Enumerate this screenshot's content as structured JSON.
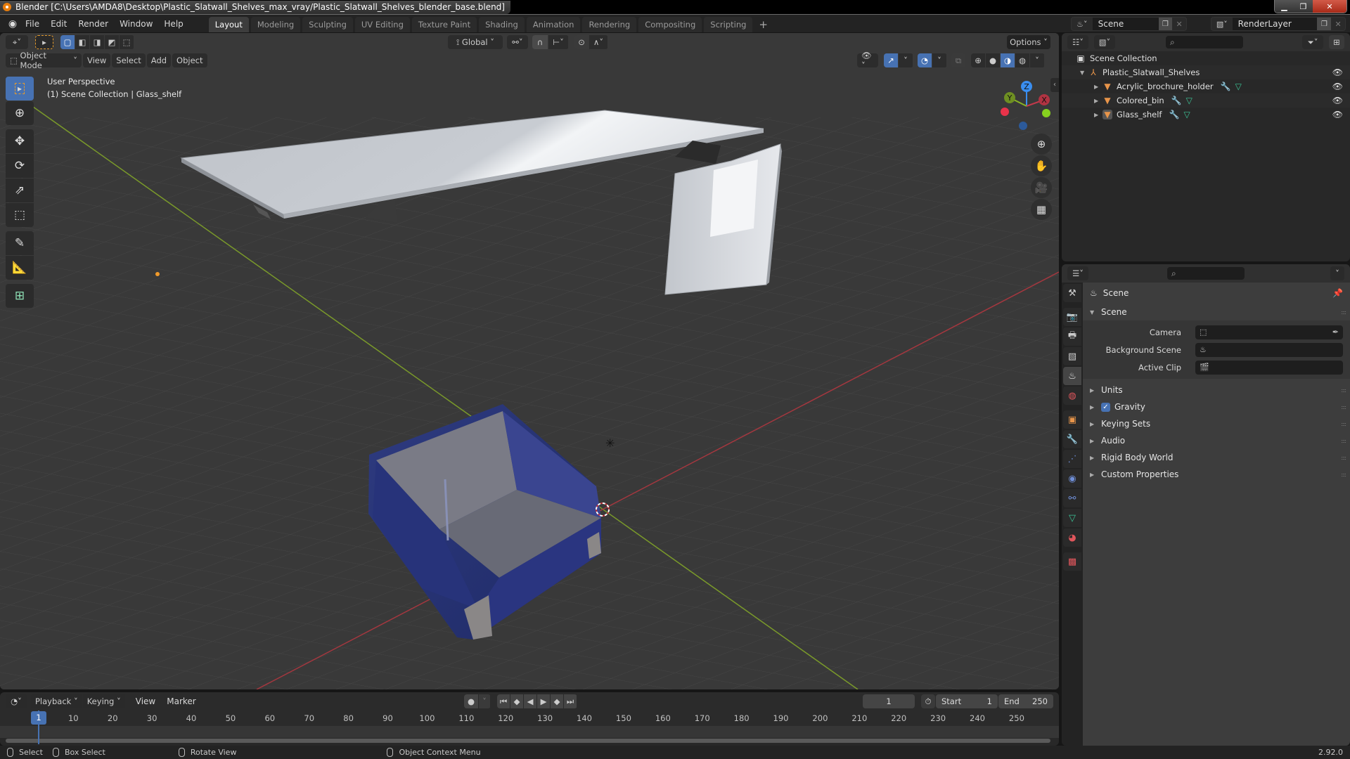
{
  "window": {
    "title": "Blender [C:\\Users\\AMDA8\\Desktop\\Plastic_Slatwall_Shelves_max_vray/Plastic_Slatwall_Shelves_blender_base.blend]",
    "minimize": "▁",
    "maximize": "❐",
    "close": "✕"
  },
  "menu": {
    "items": [
      "File",
      "Edit",
      "Render",
      "Window",
      "Help"
    ]
  },
  "workspaces": {
    "tabs": [
      "Layout",
      "Modeling",
      "Sculpting",
      "UV Editing",
      "Texture Paint",
      "Shading",
      "Animation",
      "Rendering",
      "Compositing",
      "Scripting"
    ],
    "active": "Layout",
    "add": "+"
  },
  "scene_selector": {
    "name": "Scene"
  },
  "layer_selector": {
    "name": "RenderLayer"
  },
  "viewport": {
    "transform_orientation": "Global",
    "options_label": "Options",
    "mode": "Object Mode",
    "menus": [
      "View",
      "Select",
      "Add",
      "Object"
    ],
    "view_name": "User Perspective",
    "context_line": "(1) Scene Collection | Glass_shelf",
    "gizmo": {
      "x": "X",
      "y": "Y",
      "z": "Z"
    },
    "colors": {
      "x_axis": "#c2394b",
      "y_axis": "#8ab523",
      "z_axis": "#3a8ef0",
      "grid_bg": "#393939",
      "accent": "#4772b3"
    },
    "tools": [
      "select-box",
      "cursor",
      "move",
      "rotate",
      "scale",
      "transform",
      "annotate",
      "measure",
      "add-cube"
    ],
    "nav_buttons": [
      "zoom",
      "pan",
      "camera",
      "ortho-toggle"
    ]
  },
  "outliner": {
    "root": "Scene Collection",
    "collection": "Plastic_Slatwall_Shelves",
    "objects": [
      {
        "name": "Acrylic_brochure_holder"
      },
      {
        "name": "Colored_bin"
      },
      {
        "name": "Glass_shelf",
        "active": true
      }
    ]
  },
  "properties": {
    "context_title": "Scene",
    "panel_scene": {
      "title": "Scene",
      "rows": [
        {
          "label": "Camera",
          "value": ""
        },
        {
          "label": "Background Scene",
          "value": ""
        },
        {
          "label": "Active Clip",
          "value": ""
        }
      ]
    },
    "collapsed_panels": [
      {
        "title": "Units"
      },
      {
        "title": "Gravity",
        "checkbox": true
      },
      {
        "title": "Keying Sets"
      },
      {
        "title": "Audio"
      },
      {
        "title": "Rigid Body World"
      },
      {
        "title": "Custom Properties"
      }
    ],
    "tabs": [
      "tool",
      "render",
      "output",
      "view-layer",
      "scene",
      "world",
      "object",
      "modifiers",
      "particles",
      "physics",
      "constraints",
      "data",
      "material",
      "texture"
    ],
    "active_tab": "scene"
  },
  "timeline": {
    "menus": [
      "Playback",
      "Keying",
      "View",
      "Marker"
    ],
    "current_frame": "1",
    "start_label": "Start",
    "start": "1",
    "end_label": "End",
    "end": "250",
    "ruler": [
      "10",
      "20",
      "30",
      "40",
      "50",
      "60",
      "70",
      "80",
      "90",
      "100",
      "110",
      "120",
      "130",
      "140",
      "150",
      "160",
      "170",
      "180",
      "190",
      "200",
      "210",
      "220",
      "230",
      "240",
      "250"
    ]
  },
  "statusbar": {
    "items": [
      "Select",
      "Box Select",
      "Rotate View",
      "Object Context Menu"
    ],
    "version": "2.92.0"
  }
}
